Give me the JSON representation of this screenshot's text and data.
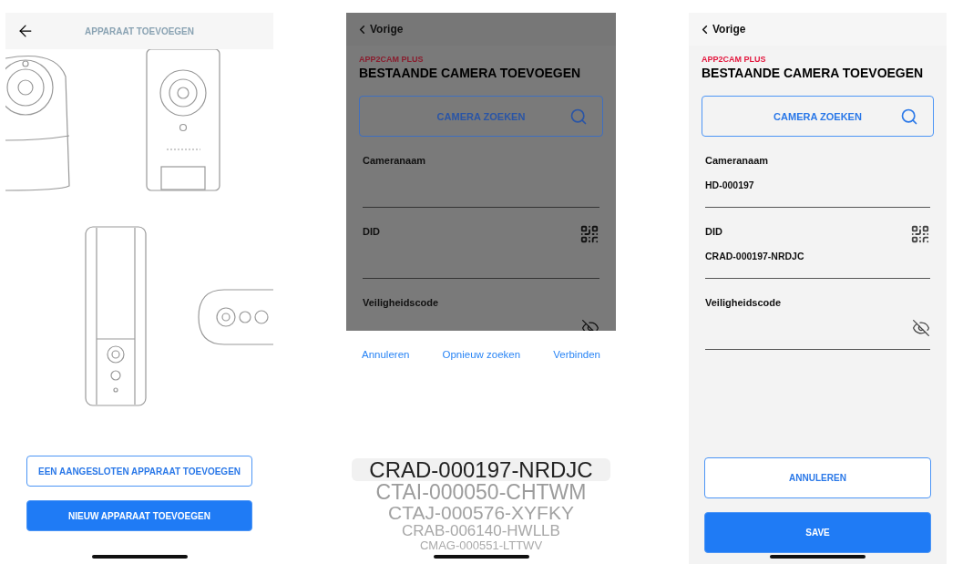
{
  "add_device": {
    "title": "APPARAAT TOEVOEGEN",
    "buttons": [
      {
        "label": "EEN AANGESLOTEN APPARAAT TOEVOEGEN",
        "kind": "outline"
      },
      {
        "label": "NIEUW APPARAAT TOEVOEGEN",
        "kind": "primary"
      }
    ]
  },
  "search_picker": {
    "dimmed": true,
    "back": "Vorige",
    "brand": "APP2CAM PLUS",
    "title": "BESTAANDE CAMERA TOEVOEGEN",
    "search_button": "CAMERA ZOEKEN",
    "fields": [
      {
        "label": "Cameranaam",
        "kind": "text"
      },
      {
        "label": "DID",
        "kind": "did"
      },
      {
        "label": "Veiligheidscode",
        "kind": "password"
      }
    ],
    "actions": [
      "Annuleren",
      "Opnieuw zoeken",
      "Verbinden"
    ],
    "options": [
      {
        "label": "CRAD-000197-NRDJC",
        "selected": true
      },
      {
        "label": "CTAI-000050-CHTWM",
        "selected": false
      },
      {
        "label": "CTAJ-000576-XYFKY",
        "selected": false
      },
      {
        "label": "CRAB-006140-HWLLB",
        "selected": false
      },
      {
        "label": "CMAG-000551-LTTWV",
        "selected": false
      }
    ]
  },
  "existing_camera": {
    "dimmed": false,
    "back": "Vorige",
    "brand": "APP2CAM PLUS",
    "title": "BESTAANDE CAMERA TOEVOEGEN",
    "search_button": "CAMERA ZOEKEN",
    "fields": [
      {
        "label": "Cameranaam",
        "kind": "text",
        "value": "HD-000197"
      },
      {
        "label": "DID",
        "kind": "did",
        "value": "CRAD-000197-NRDJC"
      },
      {
        "label": "Veiligheidscode",
        "kind": "password"
      }
    ],
    "buttons": [
      {
        "label": "ANNULEREN",
        "kind": "outline"
      },
      {
        "label": "SAVE",
        "kind": "primary"
      }
    ]
  }
}
